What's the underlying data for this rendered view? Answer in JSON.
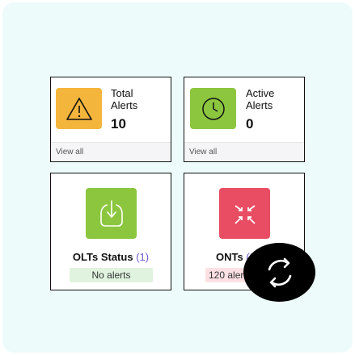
{
  "cards": {
    "total_alerts": {
      "label_line1": "Total",
      "label_line2": "Alerts",
      "value": "10",
      "footer_link": "View all",
      "icon": "warning-triangle-icon",
      "icon_bg": "#f4b53c"
    },
    "active_alerts": {
      "label_line1": "Active",
      "label_line2": "Alerts",
      "value": "0",
      "footer_link": "View all",
      "icon": "clock-icon",
      "icon_bg": "#8cc63f"
    },
    "olts": {
      "title": "OLTs Status",
      "count": "(1)",
      "status": "No alerts",
      "status_bg": "#dff3df",
      "icon": "olt-device-icon",
      "icon_bg": "#8cc63f"
    },
    "onts": {
      "title": "ONTs",
      "count": "(2",
      "status": "120 aler",
      "status_bg": "#fde0e3",
      "icon": "ont-expand-arrows-icon",
      "icon_bg": "#e94d63"
    }
  },
  "overlay": {
    "icon": "refresh-icon"
  }
}
